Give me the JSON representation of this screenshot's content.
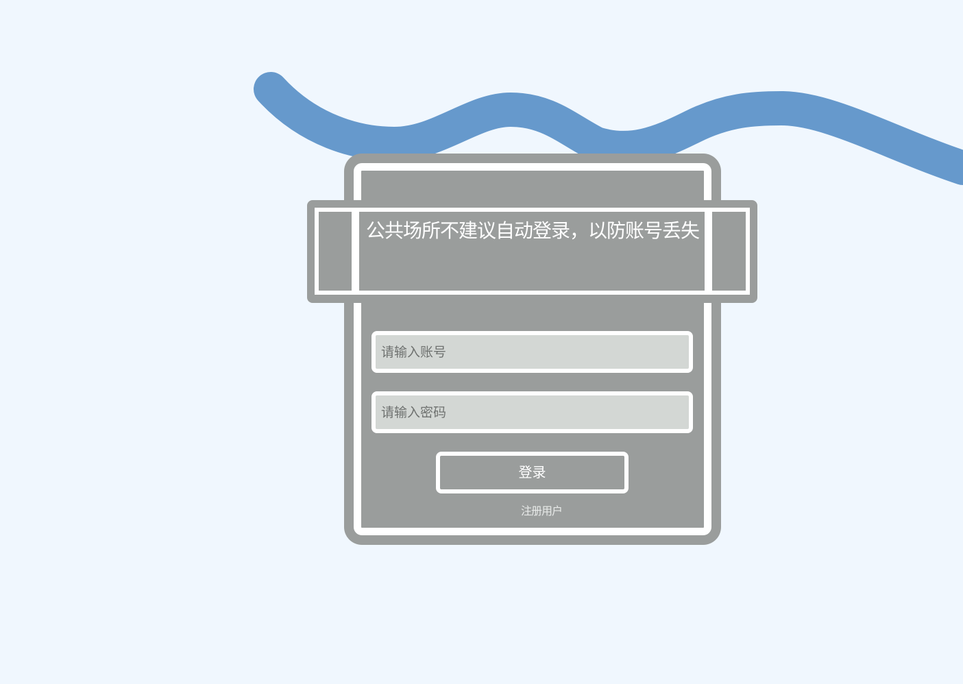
{
  "colors": {
    "background": "#f0f7fe",
    "card": "#9a9d9c",
    "wave": "#6699cc",
    "input": "#d3d7d4",
    "border": "#ffffff"
  },
  "banner": {
    "text": "公共场所不建议自动登录，以防账号丢失"
  },
  "form": {
    "username_placeholder": "请输入账号",
    "password_placeholder": "请输入密码",
    "login_label": "登录",
    "register_label": "注册用户"
  }
}
